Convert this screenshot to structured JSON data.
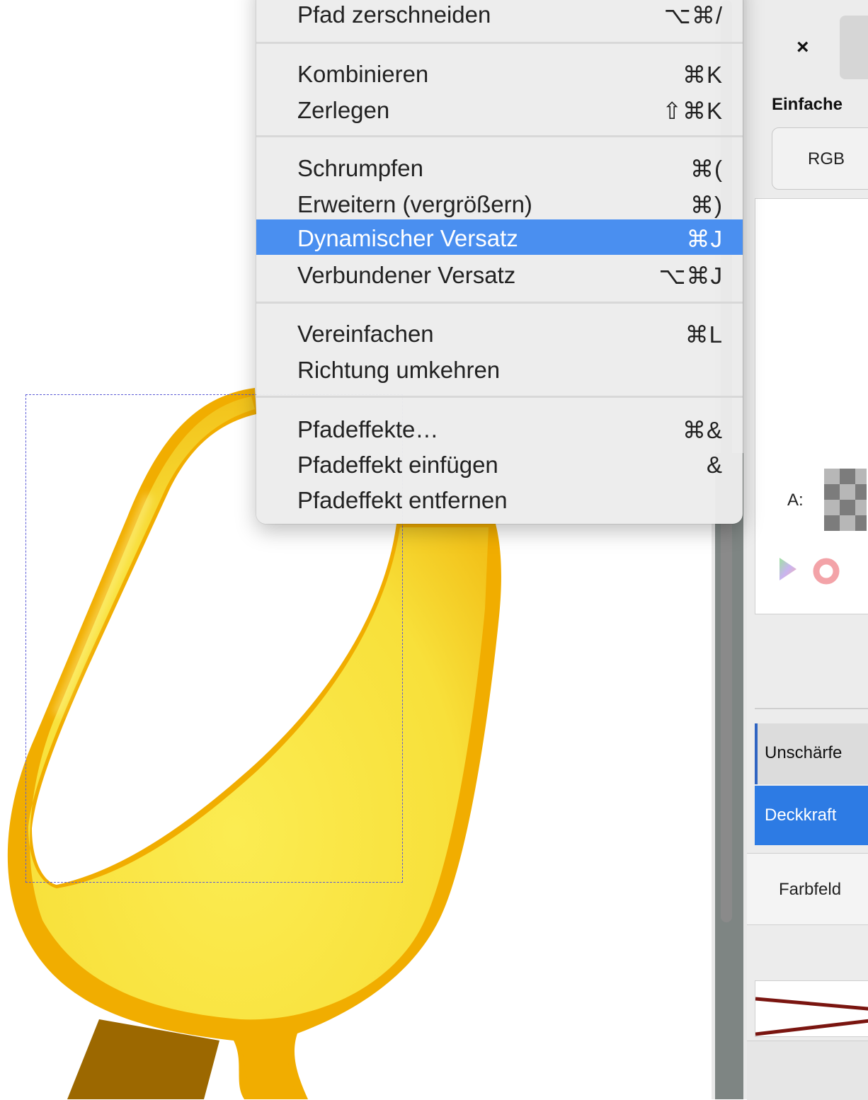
{
  "menu": {
    "items": [
      {
        "label": "Pfad zerschneiden",
        "shortcut": "⌥⌘/"
      },
      {
        "label": "Kombinieren",
        "shortcut": "⌘K"
      },
      {
        "label": "Zerlegen",
        "shortcut": "⇧⌘K"
      },
      {
        "label": "Schrumpfen",
        "shortcut": "⌘("
      },
      {
        "label": "Erweitern (vergrößern)",
        "shortcut": "⌘)"
      },
      {
        "label": "Dynamischer Versatz",
        "shortcut": "⌘J"
      },
      {
        "label": "Verbundener Versatz",
        "shortcut": "⌥⌘J"
      },
      {
        "label": "Vereinfachen",
        "shortcut": "⌘L"
      },
      {
        "label": "Richtung umkehren",
        "shortcut": ""
      },
      {
        "label": "Pfadeffekte…",
        "shortcut": "⌘&"
      },
      {
        "label": "Pfadeffekt einfügen",
        "shortcut": "&"
      },
      {
        "label": "Pfadeffekt entfernen",
        "shortcut": ""
      }
    ],
    "highlighted": "Dynamischer Versatz"
  },
  "dock": {
    "close_symbol": "×",
    "mode_label": "Einfache",
    "rgb_tab": "RGB",
    "alpha_label": "A:",
    "filters": [
      "Unschärfe",
      "Deckkraft"
    ],
    "tab_label": "Farbfeld"
  },
  "colors": {
    "highlight": "#4a8ff0",
    "active_filter": "#2d7be4",
    "artwork_yellow": "#f9e640",
    "artwork_orange": "#f0a800",
    "stick_brown": "#9c6800",
    "selection_dash": "#5b5bd6"
  }
}
